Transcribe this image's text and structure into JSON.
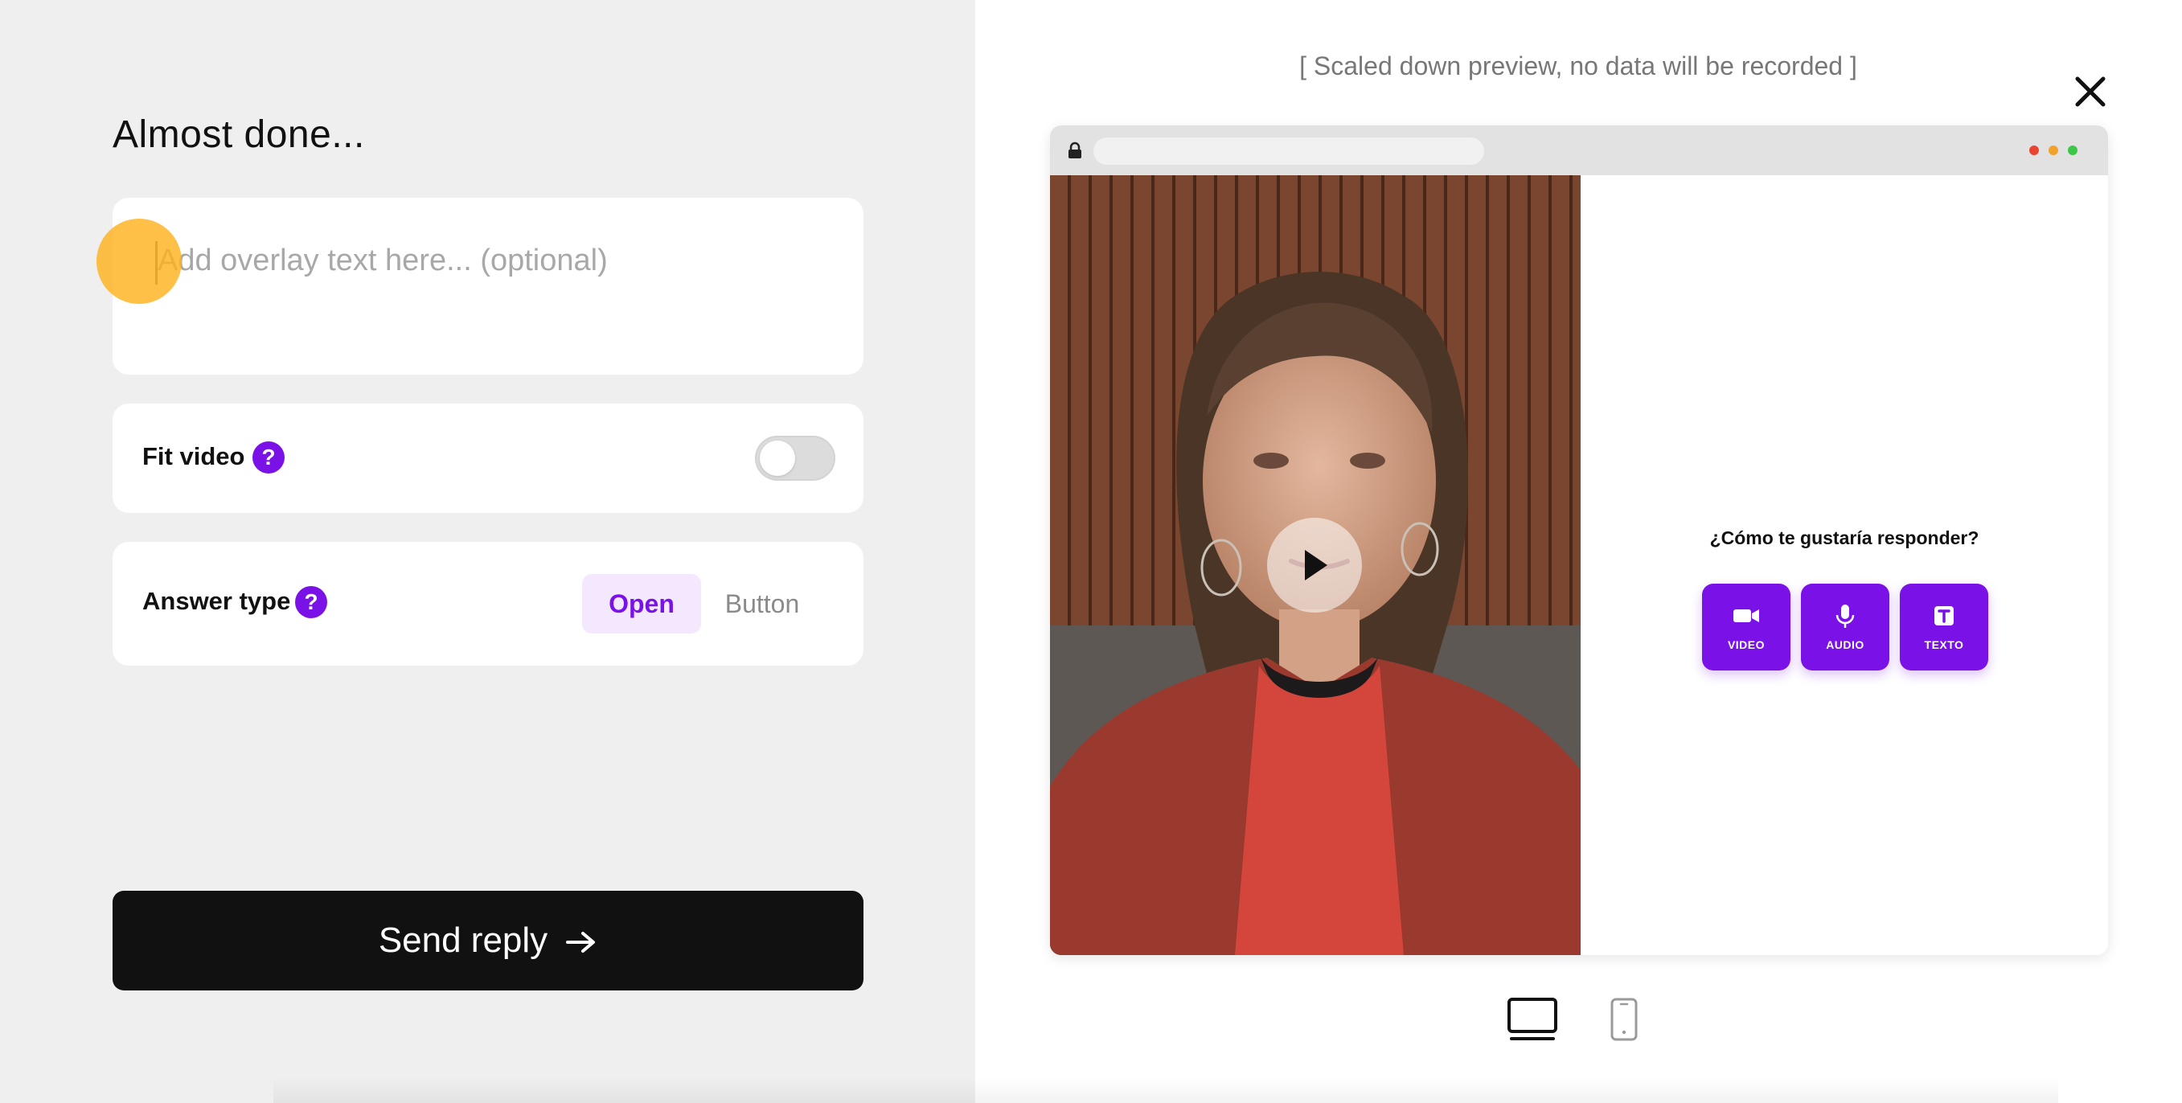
{
  "left": {
    "heading": "Almost done...",
    "overlay_placeholder": "Add overlay text here... (optional)",
    "fit_video_label": "Fit video",
    "fit_video_on": false,
    "help_glyph": "?",
    "answer_type_label": "Answer type",
    "answer_type_options": [
      "Open",
      "Button"
    ],
    "answer_type_selected": "Open",
    "send_label": "Send reply"
  },
  "preview": {
    "note": "[ Scaled down preview, no data will be recorded ]",
    "question": "¿Cómo te gustaría responder?",
    "response_options": [
      "VIDEO",
      "AUDIO",
      "TEXTO"
    ],
    "selected_device": "desktop"
  },
  "icons": [
    "close-icon",
    "lock-icon",
    "play-icon",
    "video-camera-icon",
    "microphone-icon",
    "text-icon",
    "desktop-icon",
    "mobile-icon",
    "arrow-right-icon",
    "help-icon"
  ],
  "colors": {
    "accent": "#7a12e8",
    "accent_light": "#f4e8ff",
    "primary_button": "#111111",
    "left_background": "#efefef",
    "cursor_highlight": "#ffb21e"
  }
}
